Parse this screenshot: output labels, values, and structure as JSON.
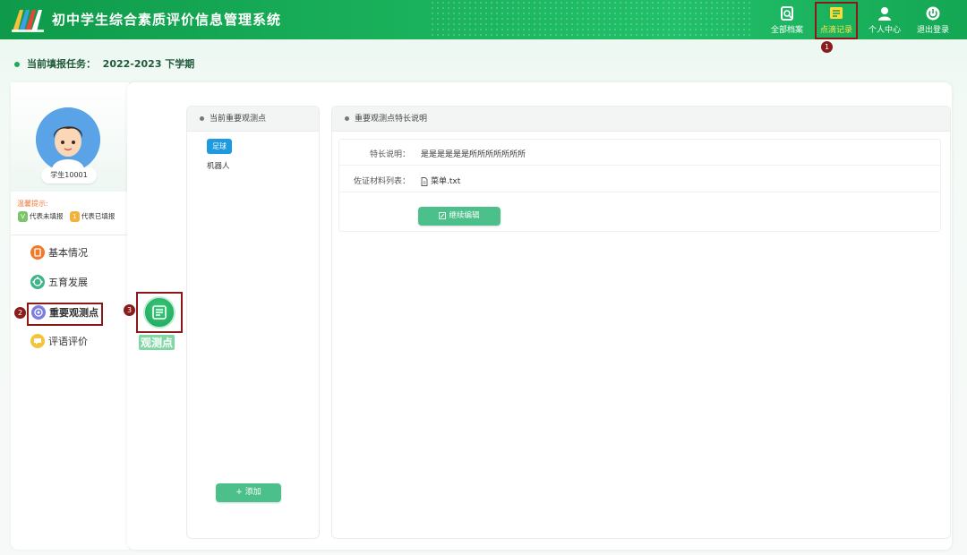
{
  "header": {
    "app_title": "初中学生综合素质评价信息管理系统",
    "nav": [
      {
        "label": "全部档案",
        "icon": "archive-icon"
      },
      {
        "label": "点滴记录",
        "icon": "record-icon"
      },
      {
        "label": "个人中心",
        "icon": "user-icon"
      },
      {
        "label": "退出登录",
        "icon": "power-icon"
      }
    ],
    "active_nav": "点滴记录"
  },
  "task": {
    "label": "当前填报任务：",
    "value": "2022-2023 下学期"
  },
  "profile": {
    "student_id": "学生10001"
  },
  "tips": {
    "title": "温馨提示:",
    "unfilled_badge": "V",
    "unfilled": "代表未填报",
    "filled_badge": "1",
    "filled": "代表已填报"
  },
  "menu": [
    {
      "label": "基本情况",
      "icon": "basic-info-icon"
    },
    {
      "label": "五育发展",
      "icon": "development-icon"
    },
    {
      "label": "重要观测点",
      "icon": "observation-point-icon"
    },
    {
      "label": "评语评价",
      "icon": "comment-icon"
    }
  ],
  "tool": {
    "label": "观测点"
  },
  "points_panel": {
    "title": "当前重要观测点",
    "items": [
      "足球",
      "机器人"
    ],
    "add_label": "+ 添加"
  },
  "desc_panel": {
    "title": "重要观测点特长说明",
    "specialty_label": "特长说明：",
    "specialty_value": "是是是是是是所所所所所所所",
    "files_label": "佐证材料列表：",
    "file_name": "菜单.txt",
    "edit_label": "继续编辑"
  },
  "markers": [
    "1",
    "2",
    "3"
  ],
  "colors": {
    "brand_green": "#1bb35d",
    "button_green": "#4cc08a",
    "tag_blue": "#1e9be0",
    "highlight_border": "#8a1a1a"
  }
}
